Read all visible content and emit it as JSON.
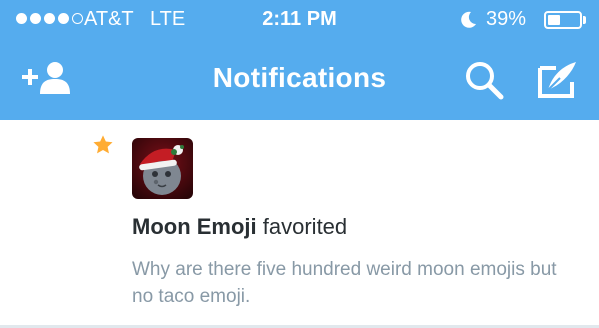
{
  "status_bar": {
    "carrier": "AT&T",
    "network": "LTE",
    "time": "2:11 PM",
    "battery_percent": "39%",
    "battery_level": 0.39,
    "signal_bars": 4,
    "signal_total": 5
  },
  "nav": {
    "title": "Notifications",
    "left_icon": "add-user-icon",
    "right_icons": [
      "search-icon",
      "compose-icon"
    ]
  },
  "notification": {
    "type_icon": "star-icon",
    "user_name": "Moon Emoji",
    "action": " favorited",
    "tweet_text": "Why are there five hundred weird moon emojis but no taco emoji.",
    "avatar": "moon-santa-hat-avatar"
  },
  "colors": {
    "brand": "#55acee",
    "star": "#ffac33",
    "secondary_text": "#8899a6",
    "primary_text": "#292f33"
  }
}
